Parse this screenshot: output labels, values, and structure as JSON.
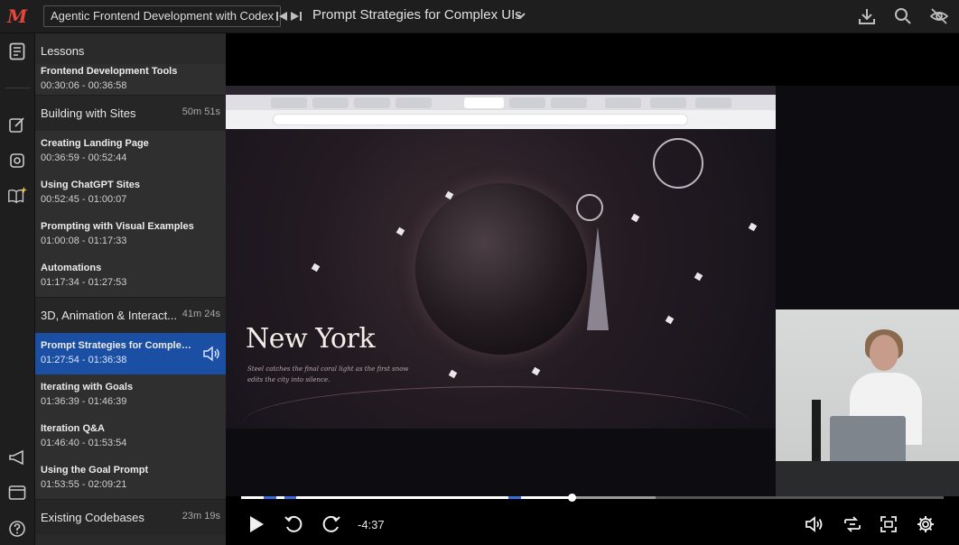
{
  "topbar": {
    "course_title": "Agentic Frontend Development with Codex",
    "lesson_title": "Prompt Strategies for Complex UIs",
    "icons": [
      "skip-back-icon",
      "skip-forward-icon",
      "chevron-down-icon",
      "download-icon",
      "search-icon",
      "eye-off-icon"
    ]
  },
  "logo": {
    "glyph": "M",
    "color": "#e8453c"
  },
  "rail": {
    "icons": [
      "lessons-icon",
      "notes-icon",
      "ai-assistant-icon",
      "sparkle-book-icon",
      "announcements-icon",
      "resources-icon",
      "help-icon"
    ]
  },
  "panel": {
    "header": "Lessons",
    "partial_item": {
      "title": "Frontend Development Tools",
      "time": "00:30:06 - 00:36:58"
    },
    "sections": [
      {
        "title": "Building with Sites",
        "duration": "50m 51s",
        "items": [
          {
            "title": "Creating Landing Page",
            "time": "00:36:59 - 00:52:44"
          },
          {
            "title": "Using ChatGPT Sites",
            "time": "00:52:45 - 01:00:07"
          },
          {
            "title": "Prompting with Visual Examples",
            "time": "01:00:08 - 01:17:33"
          },
          {
            "title": "Automations",
            "time": "01:17:34 - 01:27:53"
          }
        ]
      },
      {
        "title": "3D, Animation & Interact...",
        "duration": "41m 24s",
        "items": [
          {
            "title": "Prompt Strategies for Complex ...",
            "time": "01:27:54 - 01:36:38",
            "active": true
          },
          {
            "title": "Iterating with Goals",
            "time": "01:36:39 - 01:46:39"
          },
          {
            "title": "Iteration Q&A",
            "time": "01:46:40 - 01:53:54"
          },
          {
            "title": "Using the Goal Prompt",
            "time": "01:53:55 - 02:09:21"
          }
        ]
      },
      {
        "title": "Existing Codebases",
        "duration": "23m 19s",
        "items": []
      }
    ],
    "active_color": "#1b4fa3"
  },
  "video": {
    "scene_title": "New York",
    "scene_subtitle": "Steel catches the final coral light as the first snow edits the city into silence.",
    "player": {
      "time_remaining": "-4:37",
      "played_fraction": 0.47,
      "buffered_fraction": 0.59,
      "controls": [
        "play-icon",
        "rewind-icon",
        "forward-icon",
        "volume-icon",
        "loop-icon",
        "fullscreen-icon",
        "settings-icon"
      ]
    }
  }
}
